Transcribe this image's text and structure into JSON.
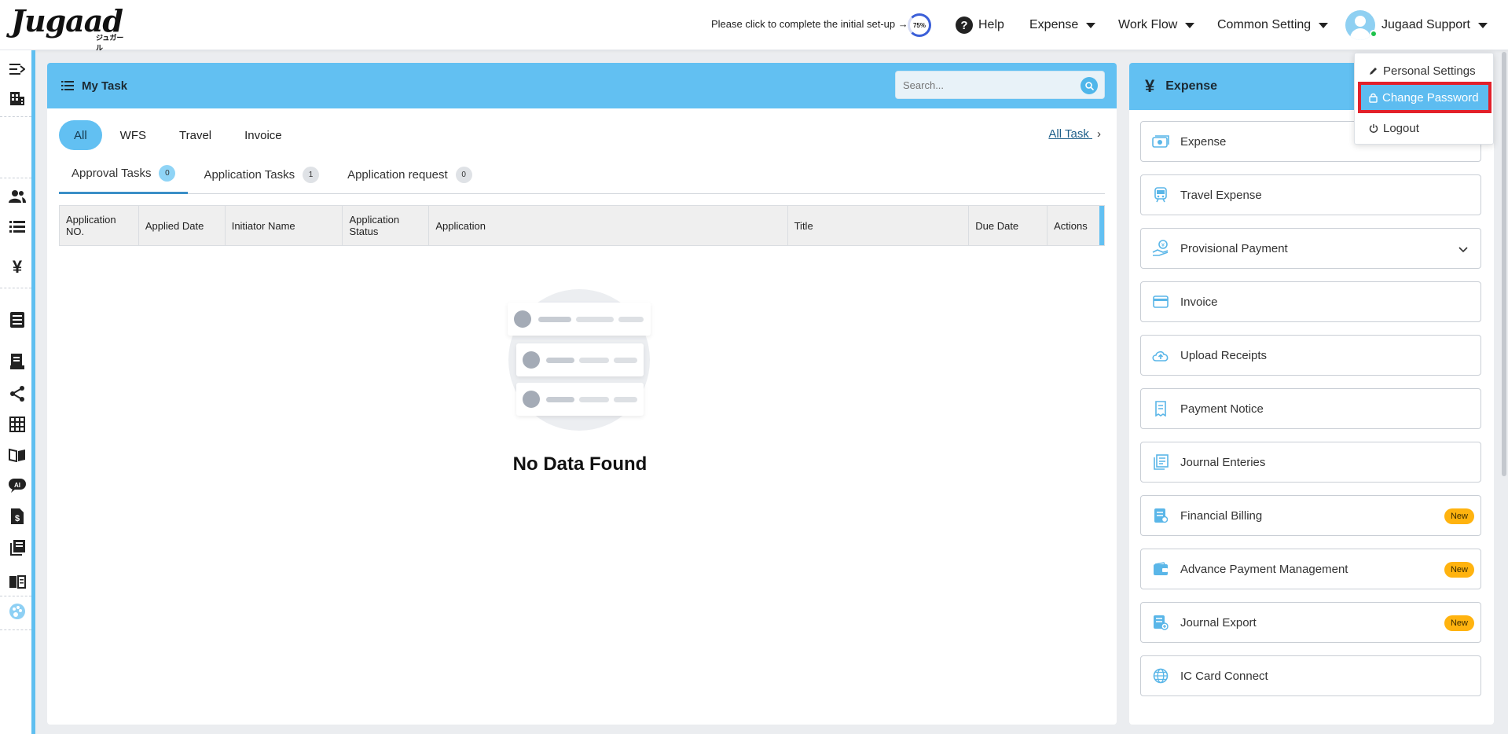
{
  "brand": {
    "logo": "Jugaad",
    "sub": "ジュガール"
  },
  "header": {
    "setup_text": "Please click to complete the initial set-up →",
    "setup_progress": "75%",
    "help": "Help",
    "menu_expense": "Expense",
    "menu_workflow": "Work Flow",
    "menu_common": "Common Setting",
    "user_name": "Jugaad Support"
  },
  "user_menu": {
    "personal": "Personal Settings",
    "change_password": "Change Password",
    "logout": "Logout"
  },
  "task": {
    "title": "My Task",
    "search_placeholder": "Search...",
    "filters": [
      "All",
      "WFS",
      "Travel",
      "Invoice"
    ],
    "all_task_link": "All Task",
    "tabs": [
      {
        "label": "Approval Tasks",
        "count": "0"
      },
      {
        "label": "Application Tasks",
        "count": "1"
      },
      {
        "label": "Application request",
        "count": "0"
      }
    ],
    "columns": [
      "Application NO.",
      "Applied Date",
      "Initiator Name",
      "Application Status",
      "Application",
      "Title",
      "Due Date",
      "Actions"
    ],
    "empty": "No Data Found"
  },
  "expense_panel": {
    "title": "Expense",
    "items": [
      {
        "label": "Expense",
        "icon": "money-icon"
      },
      {
        "label": "Travel Expense",
        "icon": "train-icon"
      },
      {
        "label": "Provisional Payment",
        "icon": "hand-coins-icon"
      },
      {
        "label": "Invoice",
        "icon": "card-icon"
      },
      {
        "label": "Upload Receipts",
        "icon": "cloud-upload-icon"
      },
      {
        "label": "Payment Notice",
        "icon": "receipt-icon"
      },
      {
        "label": "Journal Enteries",
        "icon": "journal-icon"
      },
      {
        "label": "Financial Billing",
        "icon": "billing-icon",
        "badge": "New"
      },
      {
        "label": "Advance Payment Management",
        "icon": "wallet-icon",
        "badge": "New"
      },
      {
        "label": "Journal Export",
        "icon": "export-icon",
        "badge": "New"
      },
      {
        "label": "IC Card Connect",
        "icon": "globe-icon"
      }
    ]
  },
  "colors": {
    "accent": "#62c0f2",
    "highlight": "#e2202a",
    "badge": "#ffb30f"
  }
}
